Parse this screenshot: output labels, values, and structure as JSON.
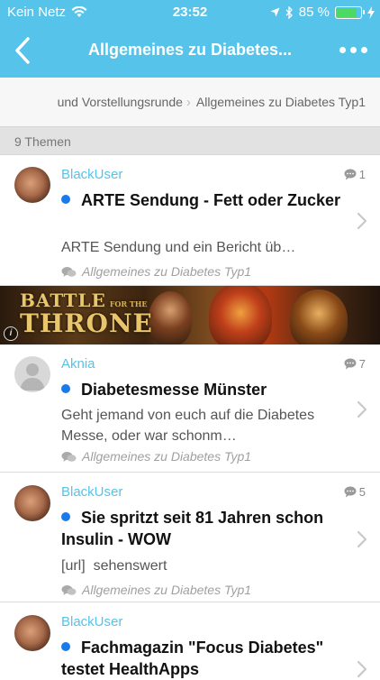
{
  "status_bar": {
    "carrier": "Kein Netz",
    "time": "23:52",
    "battery": "85 %",
    "battery_level": 0.85,
    "battery_color": "#4cd964"
  },
  "nav": {
    "title": "Allgemeines zu Diabetes...",
    "back_icon": "chevron-left-icon",
    "more_icon": "more-dots-icon",
    "accent_color": "#55c3ea"
  },
  "breadcrumb": {
    "items": [
      "und Vorstellungsrunde",
      "Allgemeines zu Diabetes Typ1"
    ]
  },
  "section": {
    "count_label": "9 Themen"
  },
  "topics": [
    {
      "user": "BlackUser",
      "replies": "1",
      "title": "ARTE Sendung - Fett oder Zucker",
      "excerpt": "ARTE Sendung und ein Bericht üb…",
      "forum": "Allgemeines zu Diabetes Typ1",
      "unread": true
    },
    {
      "user": "Aknia",
      "replies": "7",
      "title": "Diabetesmesse Münster",
      "excerpt": "Geht jemand von euch auf die Diabetes Messe, oder war schonm…",
      "forum": "Allgemeines zu Diabetes Typ1",
      "unread": true
    },
    {
      "user": "BlackUser",
      "replies": "5",
      "title": "Sie spritzt seit 81 Jahren schon Insulin - WOW",
      "excerpt": "[url]  sehenswert",
      "forum": "Allgemeines zu Diabetes Typ1",
      "unread": true
    },
    {
      "user": "BlackUser",
      "replies": "",
      "title": "Fachmagazin \"Focus Diabetes\" testet HealthApps",
      "excerpt": "",
      "forum": "",
      "unread": true
    }
  ],
  "ad": {
    "title_line1": "BATTLE",
    "title_small": "FOR THE",
    "title_line2": "THRONE",
    "info_icon": "info-icon"
  }
}
